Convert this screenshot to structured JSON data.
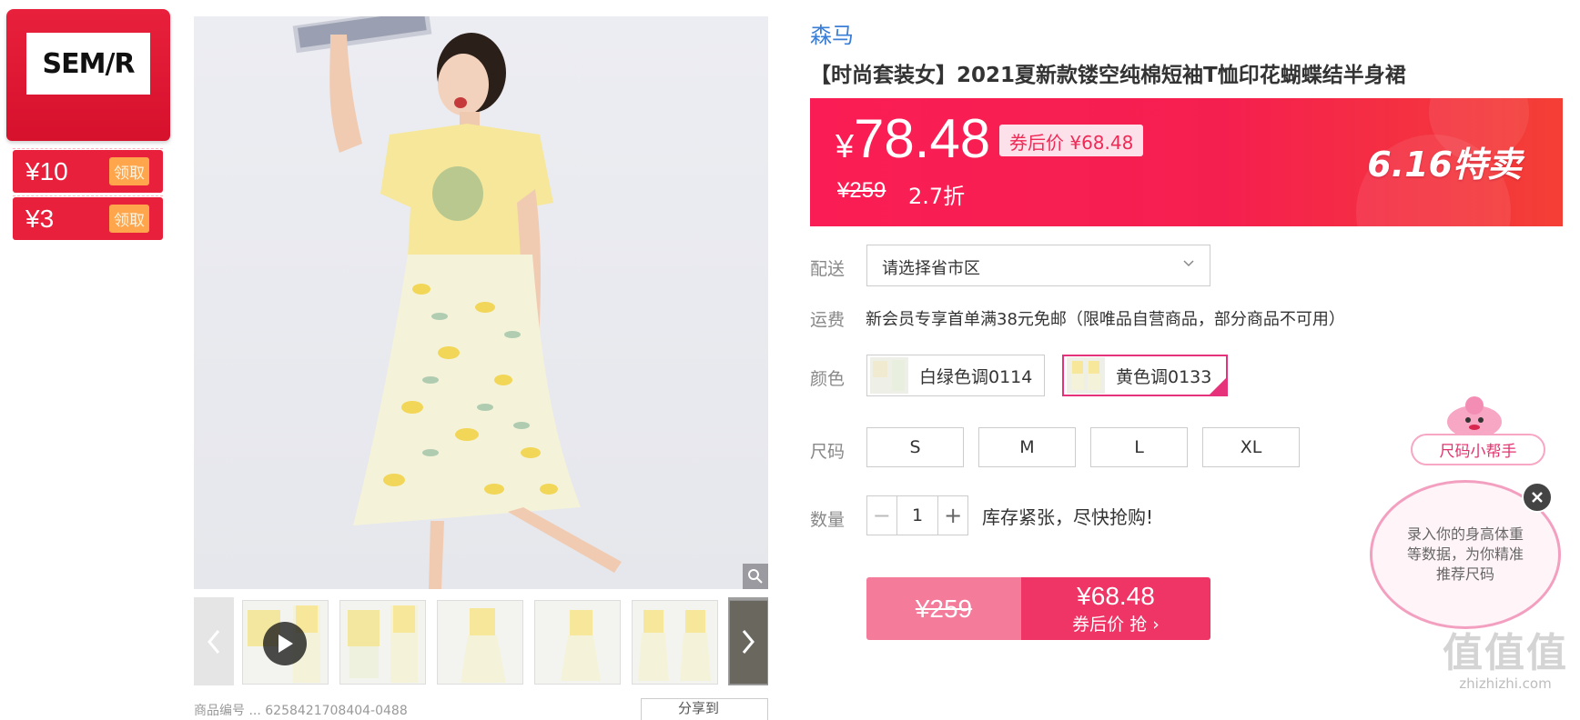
{
  "store": {
    "logo_text": "SEM/R",
    "coupons": [
      {
        "amount": "¥10",
        "button": "领取"
      },
      {
        "amount": "¥3",
        "button": "领取"
      }
    ]
  },
  "gallery": {
    "thumbnails": [
      "thumb-1",
      "thumb-2",
      "thumb-3",
      "thumb-4",
      "thumb-5",
      "thumb-6"
    ],
    "product_id_partial": "商品编号 ...  6258421708404-0488",
    "share_label": "分享到"
  },
  "product": {
    "brand": "森马",
    "title": "【时尚套装女】2021夏新款镂空纯棉短袖T恤印花蝴蝶结半身裙",
    "price_symbol": "¥",
    "price": "78.48",
    "coupon_price_label": "券后价 ¥68.48",
    "original_price": "¥259",
    "discount": "2.7折",
    "sale_badge": "6.16特卖"
  },
  "options": {
    "delivery_label": "配送",
    "delivery_placeholder": "请选择省市区",
    "freight_label": "运费",
    "freight_text": "新会员专享首单满38元免邮（限唯品自营商品，部分商品不可用）",
    "color_label": "颜色",
    "colors": [
      {
        "name": "白绿色调0114",
        "selected": false
      },
      {
        "name": "黄色调0133",
        "selected": true
      }
    ],
    "size_label": "尺码",
    "sizes": [
      "S",
      "M",
      "L",
      "XL"
    ],
    "quantity_label": "数量",
    "quantity": "1",
    "stock_text": "库存紧张，尽快抢购!"
  },
  "buy_button": {
    "original": "¥259",
    "price": "¥68.48",
    "sub": "券后价 抢 ›"
  },
  "size_helper": {
    "title": "尺码小帮手",
    "message": "录入你的身高体重等数据，为你精准推荐尺码"
  },
  "watermark": {
    "big": "值值值",
    "small": "zhizhizhi.com"
  },
  "colors": {
    "accent": "#ee3566",
    "brand_blue": "#3a7ed6",
    "coupon_red": "#e8203c"
  }
}
